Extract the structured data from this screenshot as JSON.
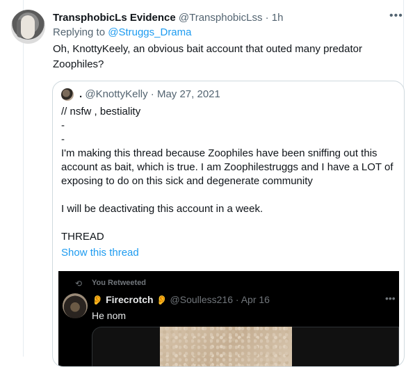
{
  "tweet": {
    "display_name": "TransphobicLs Evidence",
    "handle": "@TransphobicLss",
    "separator": "·",
    "time": "1h",
    "reply_prefix": "Replying to",
    "reply_to": "@Struggs_Drama",
    "text": "Oh, KnottyKeely, an obvious bait account that outed many predator Zoophiles?"
  },
  "quote": {
    "handle_prefix": ".",
    "handle": "@KnottyKelly",
    "separator": "·",
    "date": "May 27, 2021",
    "text": "// nsfw , bestiality\n-\n-\nI'm making this thread because Zoophiles have been sniffing out this account as bait, which is true. I am Zoophilestruggs and I have a LOT of exposing to do on this sick and degenerate community\n\nI will be deactivating this account in a week.\n\nTHREAD",
    "show_thread": "Show this thread"
  },
  "embedded": {
    "retweet_label": "You Retweeted",
    "display_name": "Firecrotch",
    "handle": "@Soulless216",
    "separator": "·",
    "date": "Apr 16",
    "text": "He nom"
  },
  "icons": {
    "more": "more-icon",
    "retweet": "retweet-icon",
    "ear": "ear-icon"
  },
  "colors": {
    "link": "#1d9bf0",
    "muted": "#536471",
    "dark_bg": "#000000"
  }
}
